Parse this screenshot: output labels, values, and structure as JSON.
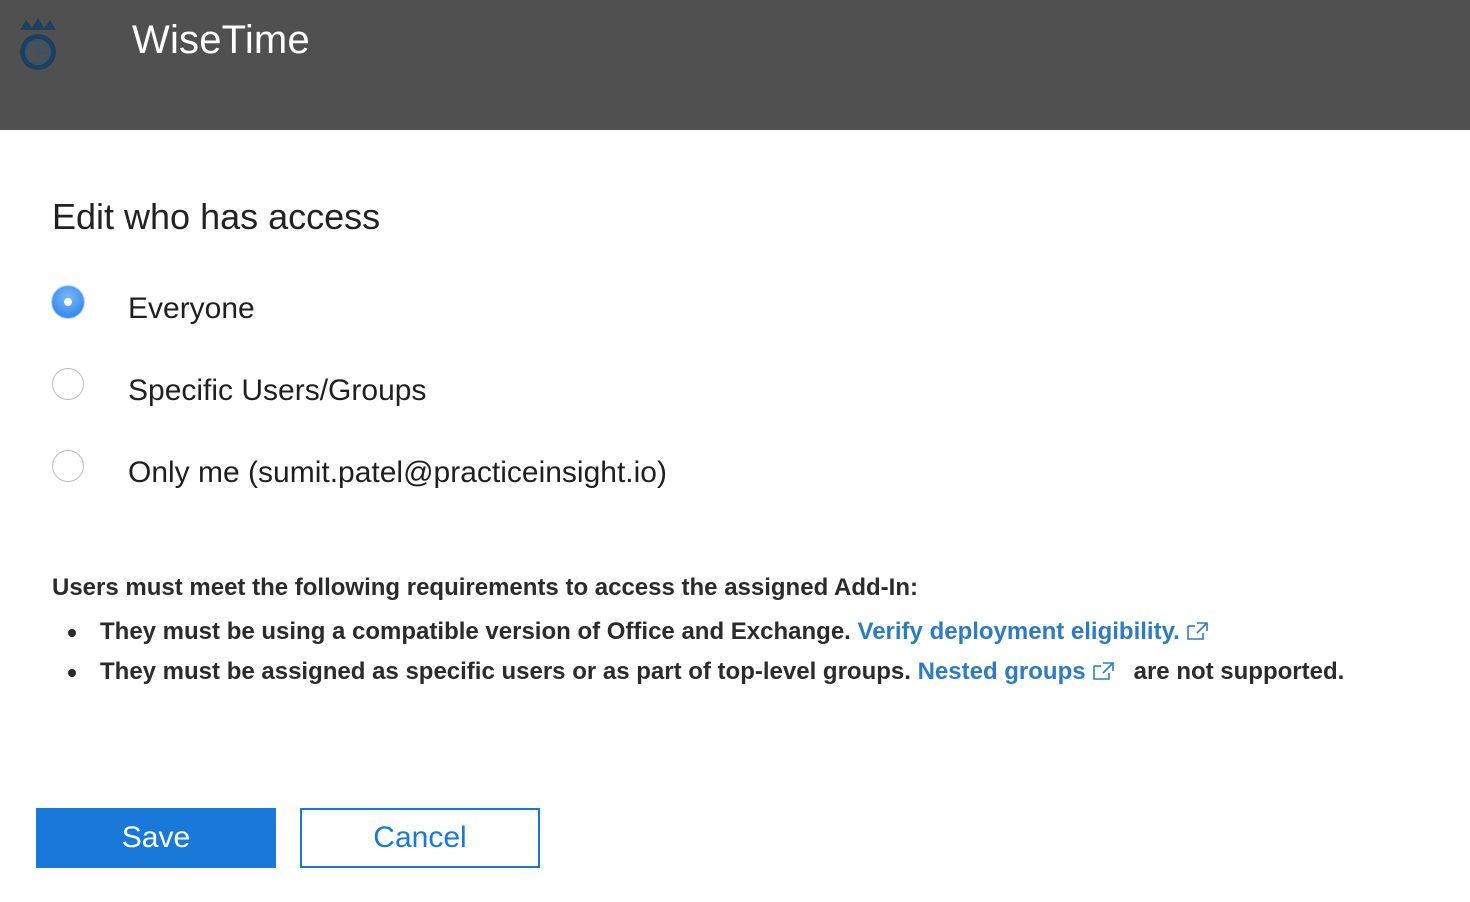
{
  "header": {
    "app_name": "WiseTime",
    "logo_icon": "wisetime-crown-clock-icon",
    "background_color": "#505050"
  },
  "page": {
    "title": "Edit who has access"
  },
  "access_options": [
    {
      "label": "Everyone",
      "checked": true
    },
    {
      "label": "Specific Users/Groups",
      "checked": false
    },
    {
      "label": "Only me (sumit.patel@practiceinsight.io)",
      "checked": false
    }
  ],
  "requirements": {
    "intro": "Users must meet the following requirements to access the assigned Add-In:",
    "items": [
      {
        "text": "They must be using a compatible version of Office and Exchange.",
        "link_label": "Verify deployment eligibility.",
        "link_icon": "external-link-icon"
      },
      {
        "text": "They must be assigned as specific users or as part of top-level groups.",
        "link_label": "Nested groups",
        "link_icon": "external-link-icon",
        "after_link_text": "are not supported."
      }
    ]
  },
  "actions": {
    "save_label": "Save",
    "cancel_label": "Cancel",
    "accent_color": "#1879d8"
  }
}
